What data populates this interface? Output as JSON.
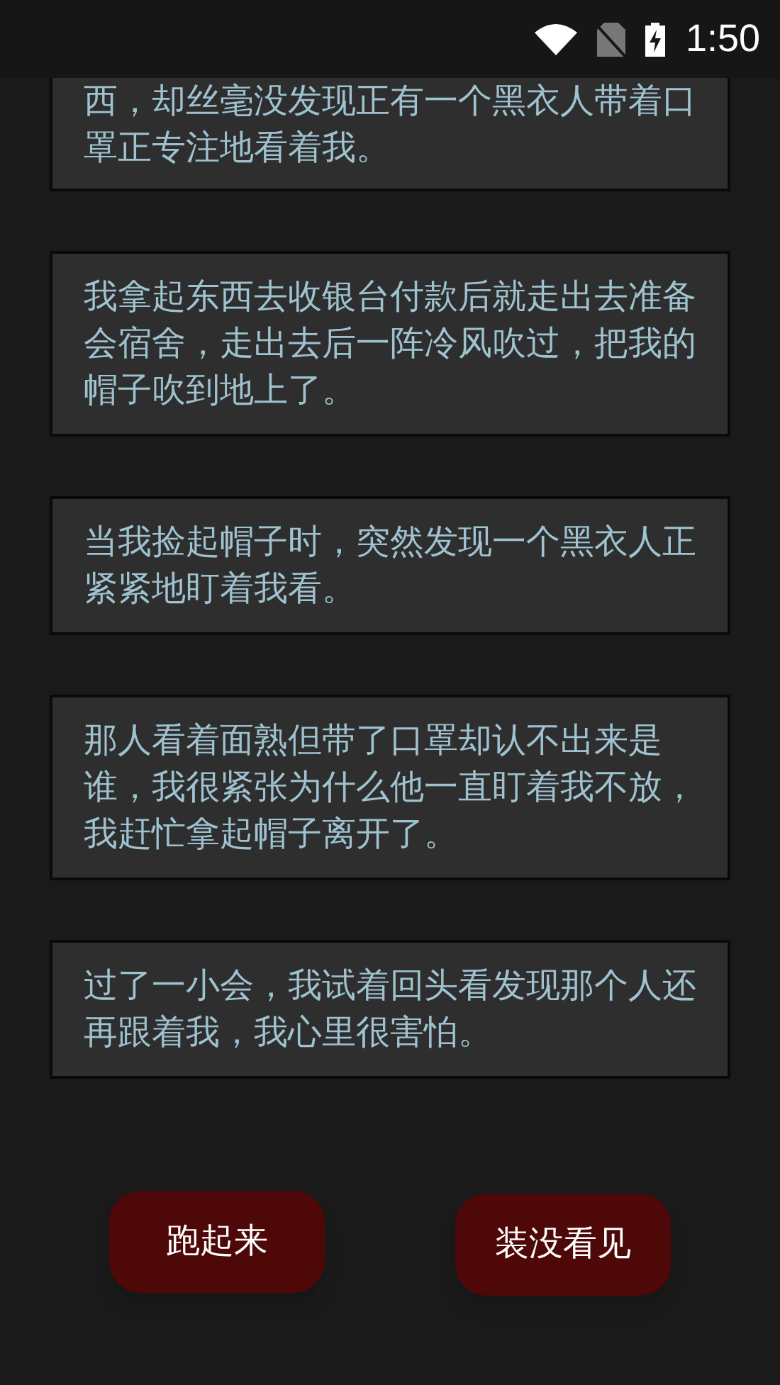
{
  "status_bar": {
    "time": "1:50"
  },
  "story_cards": [
    {
      "text": "西，却丝毫没发现正有一个黑衣人带着口罩正专注地看着我。",
      "cut_top": true
    },
    {
      "text": "我拿起东西去收银台付款后就走出去准备会宿舍，走出去后一阵冷风吹过，把我的帽子吹到地上了。",
      "cut_top": false
    },
    {
      "text": "当我捡起帽子时，突然发现一个黑衣人正紧紧地盯着我看。",
      "cut_top": false
    },
    {
      "text": "那人看着面熟但带了口罩却认不出来是谁，我很紧张为什么他一直盯着我不放，我赶忙拿起帽子离开了。",
      "cut_top": false
    },
    {
      "text": "过了一小会，我试着回头看发现那个人还再跟着我，我心里很害怕。",
      "cut_top": false
    }
  ],
  "choices": [
    "跑起来",
    "装没看见"
  ]
}
